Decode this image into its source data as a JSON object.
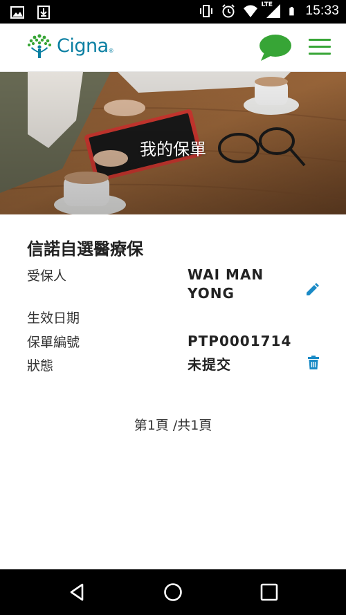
{
  "status_bar": {
    "time": "15:33",
    "network": "LTE",
    "icons": [
      "image-icon",
      "download-icon",
      "vibrate-icon",
      "alarm-icon",
      "wifi-icon",
      "signal-icon",
      "battery-icon"
    ]
  },
  "header": {
    "logo_text": "Cigna",
    "brand_color": "#37a536",
    "logo_text_color": "#0a7fa2"
  },
  "hero": {
    "title": "我的保單"
  },
  "policy": {
    "name": "信諾自選醫療保",
    "insured_label": "受保人",
    "insured_value": "WAI MAN YONG",
    "effective_date_label": "生效日期",
    "effective_date_value": "",
    "policy_number_label": "保單編號",
    "policy_number_value": "PTP0001714",
    "status_label": "狀態",
    "status_value": "未提交",
    "action_color": "#1a8ac6"
  },
  "pagination": {
    "text": "第1頁 /共1頁"
  }
}
